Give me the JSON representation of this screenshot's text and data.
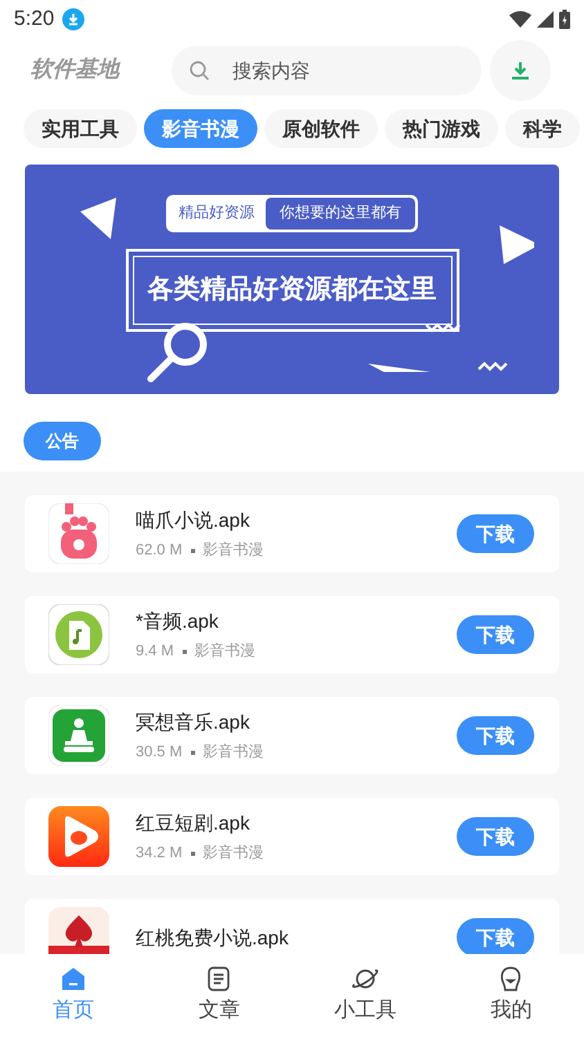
{
  "status_bar": {
    "time": "5:20"
  },
  "header": {
    "title": "软件基地",
    "search": {
      "placeholder": "搜索内容"
    }
  },
  "categories": [
    {
      "label": "实用工具",
      "selected": false
    },
    {
      "label": "影音书漫",
      "selected": true
    },
    {
      "label": "原创软件",
      "selected": false
    },
    {
      "label": "热门游戏",
      "selected": false
    },
    {
      "label": "科学",
      "selected": false
    }
  ],
  "banner": {
    "tag": "精品好资源",
    "tagline": "你想要的这里都有",
    "headline": "各类精品好资源都在这里"
  },
  "notice_button": "公告",
  "apps": [
    {
      "kind": "paw",
      "name": "喵爪小说.apk",
      "size": "62.0 M",
      "category": "影音书漫",
      "button": "下载"
    },
    {
      "kind": "audio",
      "name": "*音频.apk",
      "size": "9.4 M",
      "category": "影音书漫",
      "button": "下载"
    },
    {
      "kind": "meditation",
      "name": "冥想音乐.apk",
      "size": "30.5 M",
      "category": "影音书漫",
      "button": "下载"
    },
    {
      "kind": "bean",
      "name": "红豆短剧.apk",
      "size": "34.2 M",
      "category": "影音书漫",
      "button": "下载"
    },
    {
      "kind": "spade",
      "name": "红桃免费小说.apk",
      "button": "下载"
    }
  ],
  "nav": [
    {
      "kind": "home",
      "label": "首页",
      "selected": true
    },
    {
      "kind": "article",
      "label": "文章",
      "selected": false
    },
    {
      "kind": "planet",
      "label": "小工具",
      "selected": false
    },
    {
      "kind": "face",
      "label": "我的",
      "selected": false
    }
  ]
}
